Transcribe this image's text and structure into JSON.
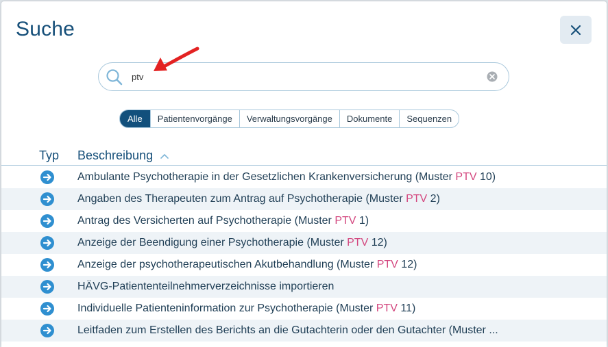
{
  "dialog": {
    "title": "Suche",
    "close_label": "×"
  },
  "search": {
    "value": "ptv",
    "placeholder": ""
  },
  "filters": [
    {
      "label": "Alle",
      "active": true
    },
    {
      "label": "Patientenvorgänge",
      "active": false
    },
    {
      "label": "Verwaltungsvorgänge",
      "active": false
    },
    {
      "label": "Dokumente",
      "active": false
    },
    {
      "label": "Sequenzen",
      "active": false
    }
  ],
  "table": {
    "columns": {
      "type": "Typ",
      "description": "Beschreibung"
    },
    "rows": [
      {
        "pre": "Ambulante Psychotherapie in der Gesetzlichen Krankenversicherung (Muster ",
        "hl": "PTV",
        "post": " 10)"
      },
      {
        "pre": "Angaben des Therapeuten zum Antrag auf Psychotherapie (Muster ",
        "hl": "PTV",
        "post": " 2)"
      },
      {
        "pre": "Antrag des Versicherten auf Psychotherapie (Muster ",
        "hl": "PTV",
        "post": " 1)"
      },
      {
        "pre": "Anzeige der Beendigung einer Psychotherapie (Muster ",
        "hl": "PTV",
        "post": " 12)"
      },
      {
        "pre": "Anzeige der psychotherapeutischen Akutbehandlung (Muster ",
        "hl": "PTV",
        "post": " 12)"
      },
      {
        "pre": "HÄVG-Patiententeilnehmerverzeichnisse importieren",
        "hl": "",
        "post": ""
      },
      {
        "pre": "Individuelle Patienteninformation zur Psychotherapie (Muster ",
        "hl": "PTV",
        "post": " 11)"
      },
      {
        "pre": "Leitfaden zum Erstellen des Berichts an die Gutachterin oder den Gutachter (Muster  ...",
        "hl": "",
        "post": ""
      }
    ]
  },
  "colors": {
    "accent": "#12507c",
    "title": "#17507a",
    "highlight": "#d3467e",
    "row_icon": "#2f8fd0",
    "annotation_arrow": "#e32222"
  },
  "icons": {
    "close": "close-icon",
    "search": "search-icon",
    "clear": "clear-icon",
    "sort": "sort-ascending-icon",
    "row_type": "arrow-right-circle-icon"
  }
}
